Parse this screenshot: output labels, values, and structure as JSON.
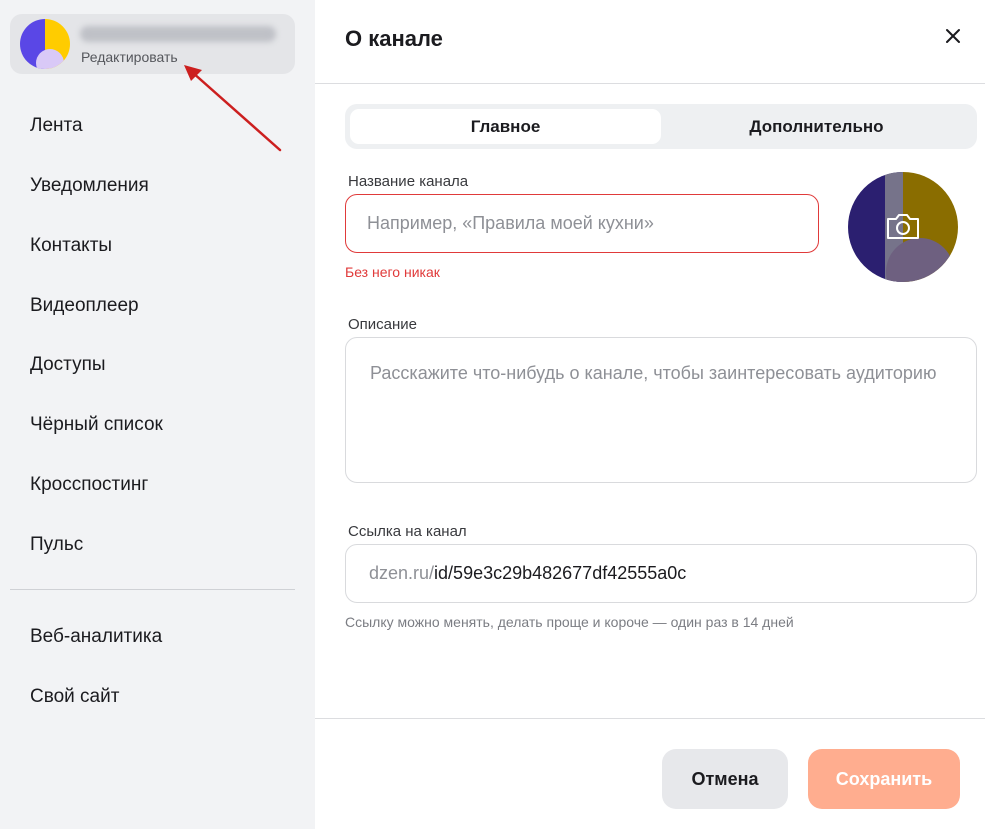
{
  "sidebar": {
    "profile": {
      "name": "",
      "edit_label": "Редактировать"
    },
    "items": [
      {
        "label": "Лента"
      },
      {
        "label": "Уведомления"
      },
      {
        "label": "Контакты"
      },
      {
        "label": "Видеоплеер"
      },
      {
        "label": "Доступы"
      },
      {
        "label": "Чёрный список"
      },
      {
        "label": "Кросспостинг"
      },
      {
        "label": "Пульс"
      },
      {
        "label": "Веб-аналитика"
      },
      {
        "label": "Свой сайт"
      }
    ]
  },
  "modal": {
    "title": "О канале",
    "tabs": [
      {
        "label": "Главное",
        "active": true
      },
      {
        "label": "Дополнительно",
        "active": false
      }
    ],
    "name_field": {
      "label": "Название канала",
      "value": "",
      "placeholder": "Например, «Правила моей кухни»",
      "error": "Без него никак"
    },
    "description_field": {
      "label": "Описание",
      "value": "",
      "placeholder": "Расскажите что-нибудь о канале, чтобы заинтересовать аудиторию"
    },
    "link_field": {
      "label": "Ссылка на канал",
      "prefix": "dzen.ru/",
      "value": "id/59e3c29b482677df42555a0c",
      "hint": "Ссылку можно менять, делать проще и короче — один раз в 14 дней"
    },
    "buttons": {
      "cancel": "Отмена",
      "save": "Сохранить"
    }
  },
  "colors": {
    "accent_error": "#e03a3a",
    "save_button": "#ffad8f",
    "annotation_arrow": "#cc1f1f"
  },
  "icons": [
    "close-icon",
    "camera-icon",
    "annotation-arrow"
  ]
}
